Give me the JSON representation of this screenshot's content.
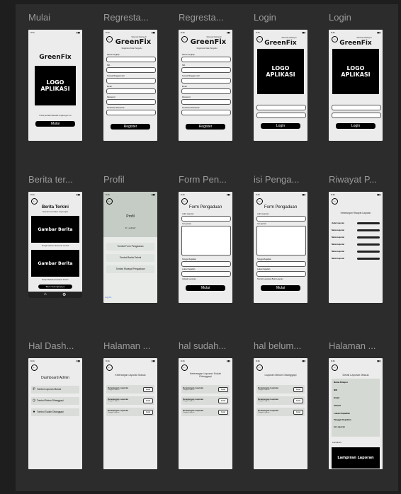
{
  "frames": {
    "mulai": {
      "title": "Mulai",
      "brand": "GreenFix",
      "logo": "LOGO APLIKASI",
      "caption": "Untuk perbaiki Masalah Lingkungan mu",
      "button": "Mulai"
    },
    "reg1": {
      "title": "Regresta...",
      "welcome": "Selamat Datang di",
      "brand": "GreenFix",
      "subtitle": "Registrasi Data Pengadu",
      "fields": [
        "Nama Lengkap",
        "NIK",
        "Tempat/Tanggal Lahir",
        "Email",
        "Password",
        "Konfirmasi Password"
      ],
      "button": "Register"
    },
    "reg2": {
      "title": "Regresta...",
      "welcome": "Selamat Datang di",
      "brand": "GreenFix",
      "subtitle": "Registrasi Data Pengadu",
      "fields": [
        "Nama Lengkap",
        "NIK",
        "Tempat/Tanggal Lahir",
        "Email",
        "Password",
        "Konfirmasi Password"
      ],
      "button": "Register"
    },
    "login1": {
      "title": "Login",
      "welcome": "Selamat Datang di",
      "brand": "GreenFix",
      "logo": "LOGO APLIKASI",
      "button": "Login"
    },
    "login2": {
      "title": "Login",
      "welcome": "Selamat Datang di",
      "brand": "GreenFix",
      "logo": "LOGO APLIKASI",
      "button": "Login"
    },
    "berita": {
      "title": "Berita ter...",
      "heading": "Berita Terkini",
      "sub": "Seputar Kerusakan Lingkungan",
      "img1": "Gambar Berita",
      "img2": "Gambar Berita",
      "cap1": "Sungai Citarum Tercemar Limbah",
      "cap2": "Banjir Melanda Kawasan Pesisir",
      "button": "Baca Selengkapnya"
    },
    "profil": {
      "title": "Profil",
      "name": "Profil",
      "id": "ID : asdfasdf",
      "menu": [
        "Tombol Form Pengaduan",
        "Tombol Berita Terkini",
        "Tombol Riwayat Pengaduan"
      ],
      "logout": "Log Out"
    },
    "form": {
      "title": "Form Pen...",
      "heading": "Form Pengaduan",
      "fields": [
        "Judul Laporan",
        "Isi Laporan",
        "Tanggal Kejadian",
        "Lokasi Kejadian",
        "Upload Lampiran"
      ],
      "button": "Mulai"
    },
    "isi": {
      "title": "isi Penga...",
      "heading": "Form Pengaduan",
      "fields": [
        "Judul Laporan",
        "Isi Laporan",
        "Tanggal Kejadian",
        "Lokasi Kejadian",
        "Tombol Lampiran Bukti Laporan"
      ],
      "button": "Mulai"
    },
    "riwayat": {
      "title": "Riwayat P...",
      "heading": "Keterangan Riwayat Laporan",
      "rows": [
        "Judul Laporan",
        "Nama Laporan",
        "Nama Laporan",
        "Nama Laporan",
        "Nama Laporan",
        "Nama Laporan"
      ]
    },
    "dash": {
      "title": "Hal Dash...",
      "heading": "Dashboard Admin",
      "items": [
        "Tombol Laporan Masuk",
        "Tombol Belum Ditanggapi",
        "Tombol Sudah Ditanggapi"
      ]
    },
    "halaman1": {
      "title": "Halaman ...",
      "heading": "Keterangan Laporan Masuk",
      "card": "Keterangan Laporan",
      "card_sub": "Tanggal Laporan",
      "card_btn": "Detail"
    },
    "sudah": {
      "title": "hal sudah...",
      "heading": "Keterangan Laporan Sudah Ditanggapi",
      "card": "Keterangan Laporan",
      "card_sub": "Tanggal Laporan",
      "card_btn": "Detail"
    },
    "belum": {
      "title": "hal belum...",
      "heading": "Laporan Belum Ditanggapi",
      "card": "Keterangan Laporan",
      "card_sub": "Tanggal Laporan",
      "card_btn": "Detail"
    },
    "halaman2": {
      "title": "Halaman ...",
      "heading": "Detail Laporan Masuk",
      "fields": [
        "Nama Pelapor",
        "NIK",
        "Email",
        "Alamat",
        "Lokasi Kejadian",
        "Tanggal Kejadian",
        "Isi Laporan"
      ],
      "lampiran_label": "Lampiran",
      "lampiran": "Lampiran Laporan"
    }
  },
  "status": {
    "time": "9:41",
    "signal": "▮▮▮"
  }
}
